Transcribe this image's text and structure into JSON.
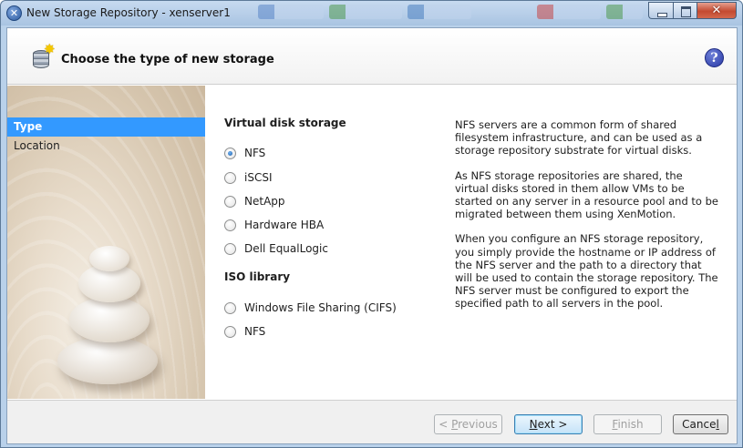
{
  "window": {
    "title": "New Storage Repository - xenserver1"
  },
  "header": {
    "title": "Choose the type of new storage",
    "help_glyph": "?"
  },
  "steps": [
    {
      "label": "Type",
      "active": true
    },
    {
      "label": "Location",
      "active": false
    }
  ],
  "options": {
    "virtual_disk_title": "Virtual disk storage",
    "virtual_disk": [
      {
        "label": "NFS",
        "checked": true
      },
      {
        "label": "iSCSI",
        "checked": false
      },
      {
        "label": "NetApp",
        "checked": false
      },
      {
        "label": "Hardware HBA",
        "checked": false
      },
      {
        "label": "Dell EqualLogic",
        "checked": false
      }
    ],
    "iso_title": "ISO library",
    "iso": [
      {
        "label": "Windows File Sharing (CIFS)",
        "checked": false
      },
      {
        "label": "NFS",
        "checked": false
      }
    ]
  },
  "description": {
    "p1": "NFS servers are a common form of shared filesystem infrastructure, and can be used as a storage repository substrate for virtual disks.",
    "p2": "As NFS storage repositories are shared, the virtual disks stored in them allow VMs to be started on any server in a resource pool and to be migrated between them using XenMotion.",
    "p3": "When you configure an NFS storage repository, you simply provide the hostname or IP address of the NFS server and the path to a directory that will be used to contain the storage repository. The NFS server must be configured to export the specified path to all servers in the pool."
  },
  "footer": {
    "previous": {
      "pre": "< ",
      "key": "P",
      "rest": "revious",
      "enabled": false
    },
    "next": {
      "key": "N",
      "rest": "ext >",
      "enabled": true
    },
    "finish": {
      "key": "F",
      "rest": "inish",
      "enabled": false
    },
    "cancel": {
      "pre": "Cance",
      "key": "l",
      "enabled": true
    }
  },
  "icons": {
    "app": "xenserver-icon",
    "header": "storage-database-icon",
    "help": "help-icon"
  }
}
